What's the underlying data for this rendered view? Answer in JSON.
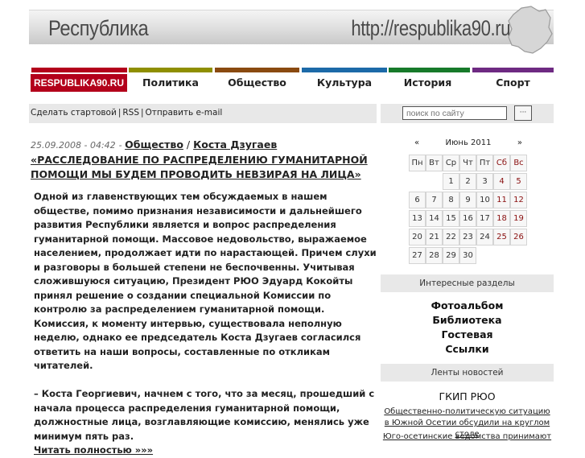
{
  "header": {
    "site_title": "Республика",
    "site_url": "http://respublika90.ru"
  },
  "colors": {
    "home": "#b3001b",
    "bar_home": "#b3001b",
    "bar_politics": "#8f8f00",
    "bar_society": "#8a4a10",
    "bar_culture": "#1c6aa8",
    "bar_history": "#177a2a",
    "bar_sport": "#6e2a82"
  },
  "nav": {
    "home": "RESPUBLIKA90.RU",
    "items": [
      "Политика",
      "Общество",
      "Культура",
      "История",
      "Спорт"
    ]
  },
  "utility": {
    "home_link": "Сделать стартовой",
    "rss": "RSS",
    "email": "Отправить e-mail",
    "separator": "|"
  },
  "search": {
    "placeholder": "поиск по сайту",
    "button": "···"
  },
  "article": {
    "date": "25.09.2008 - 04:42",
    "date_sep": " - ",
    "category": "Общество",
    "slash": " / ",
    "title": "Коста Дзугаев «РАССЛЕДОВАНИЕ ПО РАСПРЕДЕЛЕНИЮ ГУМАНИТАРНОЙ ПОМОЩИ МЫ БУДЕМ ПРОВОДИТЬ НЕВЗИРАЯ НА ЛИЦА»",
    "para1": "Одной из главенствующих тем обсуждаемых в нашем обществе, помимо признания независимости и дальнейшего развития Республики является и вопрос распределения гуманитарной помощи. Массовое недовольство, выражаемое населением, продолжает идти по нарастающей. Причем слухи и разговоры в большей степени не беспочвенны. Учитывая сложившуюся ситуацию, Президент РЮО Эдуард Кокойты принял решение о создании специальной Комиссии по контролю за распределением гуманитарной помощи. Комиссия, к моменту интервью, существовала неполную неделю, однако ее председатель Коста Дзугаев согласился ответить на наши вопросы, составленные по откликам читателей.",
    "para2": "– Коста Георгиевич, начнем с того, что за месяц, прошедший с начала процесса распределения гуманитарной помощи, должностные лица, возглавляющие комиссию, менялись уже минимум пять раз.",
    "read_more": "Читать полностью  »»»"
  },
  "calendar": {
    "prev": "«",
    "title": "Июнь 2011",
    "next": "»",
    "weekdays": [
      "Пн",
      "Вт",
      "Ср",
      "Чт",
      "Пт",
      "Сб",
      "Вс"
    ],
    "days": [
      "",
      "",
      "1",
      "2",
      "3",
      "4",
      "5",
      "6",
      "7",
      "8",
      "9",
      "10",
      "11",
      "12",
      "13",
      "14",
      "15",
      "16",
      "17",
      "18",
      "19",
      "20",
      "21",
      "22",
      "23",
      "24",
      "25",
      "26",
      "27",
      "28",
      "29",
      "30",
      "",
      "",
      ""
    ]
  },
  "sidebar": {
    "interesting_heading": "Интересные разделы",
    "interesting_links": [
      "Фотоальбом",
      "Библиотека",
      "Гостевая",
      "Ссылки"
    ],
    "news_heading": "Ленты новостей",
    "news_source": "ГКИП РЮО",
    "news_item": "Общественно-политическую ситуацию в Южной Осетии обсудили на круглом столе",
    "news_item_partial": "Юго-осетинские ведомства принимают"
  }
}
